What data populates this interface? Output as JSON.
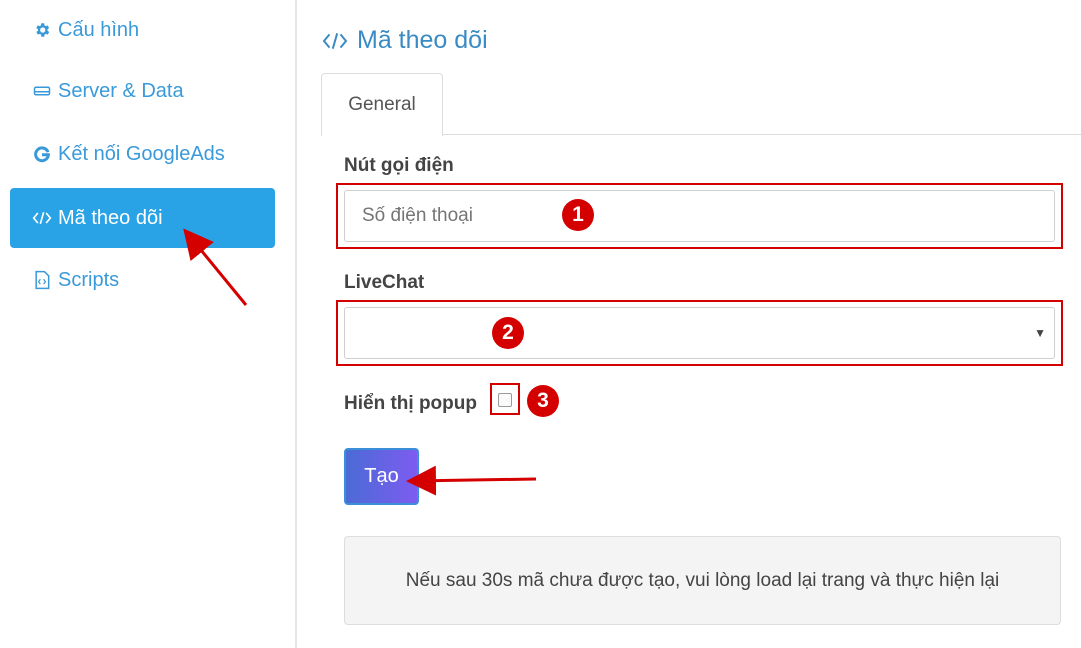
{
  "sidebar": {
    "items": [
      {
        "label": "Cấu hình",
        "icon": "gear-icon"
      },
      {
        "label": "Server & Data",
        "icon": "hard-drive-icon"
      },
      {
        "label": "Kết nối GoogleAds",
        "icon": "google-g-icon"
      },
      {
        "label": "Mã theo dõi",
        "icon": "code-icon",
        "active": true
      },
      {
        "label": "Scripts",
        "icon": "file-code-icon"
      }
    ]
  },
  "main": {
    "title": "Mã theo dõi",
    "tabs": [
      {
        "label": "General"
      }
    ],
    "form": {
      "phone_label": "Nút gọi điện",
      "phone_placeholder": "Số điện thoại",
      "livechat_label": "LiveChat",
      "livechat_value": "",
      "popup_label": "Hiển thị popup",
      "popup_checked": false,
      "submit_label": "Tạo"
    },
    "note": "Nếu sau 30s mã chưa được tạo, vui lòng load lại trang và thực hiện lại"
  },
  "annotations": {
    "badges": [
      "1",
      "2",
      "3"
    ],
    "color": "#d40000"
  },
  "colors": {
    "accent": "#2aa2e6",
    "link": "#3a9ad9",
    "annotation": "#d40000"
  }
}
